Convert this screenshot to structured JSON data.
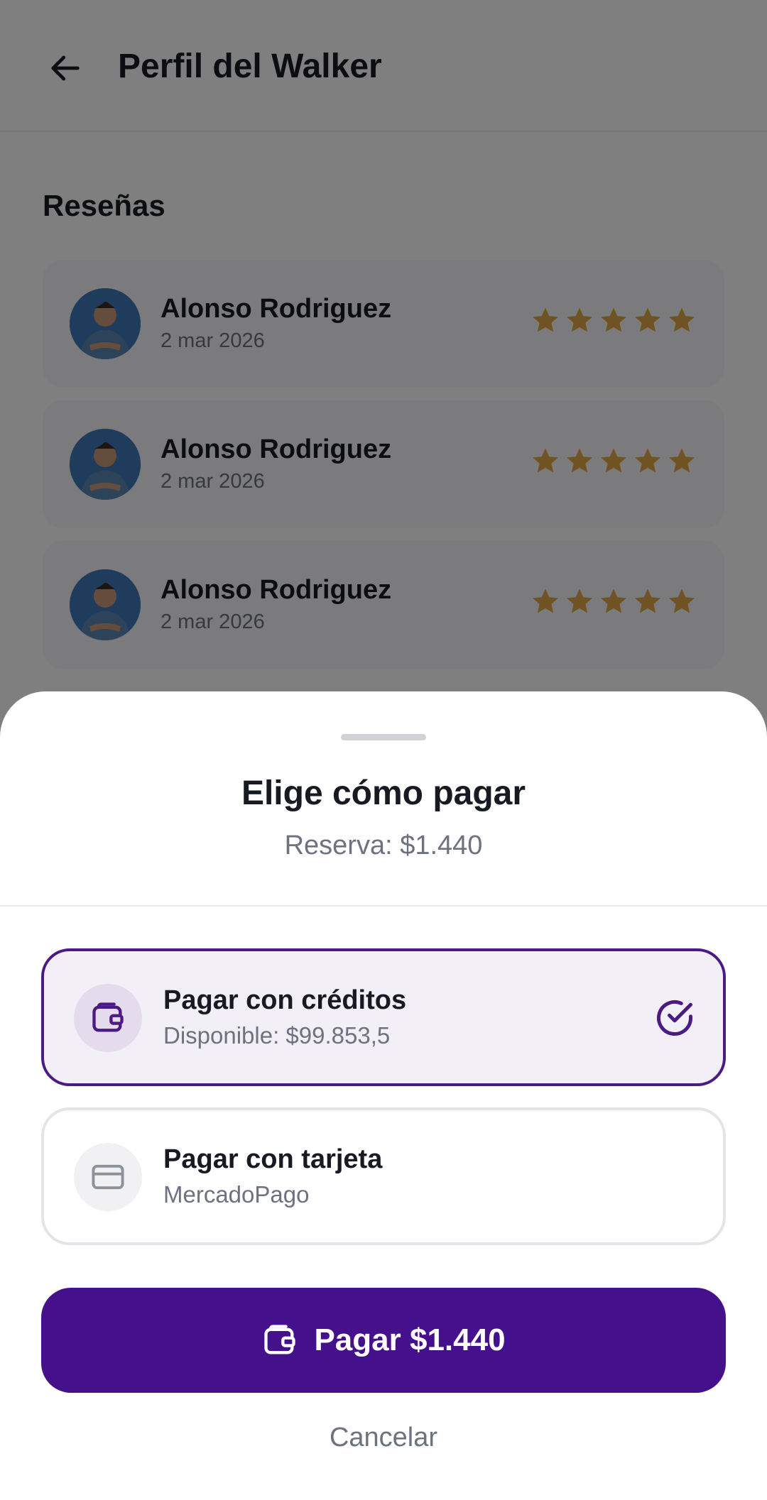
{
  "header": {
    "back_icon": "arrow-left-icon",
    "title": "Perfil del Walker"
  },
  "reviews": {
    "section_title": "Reseñas",
    "items": [
      {
        "name": "Alonso Rodriguez",
        "date": "2 mar 2026",
        "rating": 5
      },
      {
        "name": "Alonso Rodriguez",
        "date": "2 mar 2026",
        "rating": 5
      },
      {
        "name": "Alonso Rodriguez",
        "date": "2 mar 2026",
        "rating": 5
      }
    ],
    "star_color": "#e0a644"
  },
  "payment_sheet": {
    "title": "Elige cómo pagar",
    "subtitle": "Reserva: $1.440",
    "options": [
      {
        "label": "Pagar con créditos",
        "sub": "Disponible: $99.853,5",
        "icon": "wallet-icon",
        "selected": true
      },
      {
        "label": "Pagar con tarjeta",
        "sub": "MercadoPago",
        "icon": "credit-card-icon",
        "selected": false
      }
    ],
    "pay_button": {
      "label": "Pagar $1.440",
      "icon": "wallet-icon"
    },
    "cancel_label": "Cancelar"
  },
  "colors": {
    "primary": "#44108c",
    "selected_bg": "#f3eff7",
    "muted_text": "#6d7280",
    "scrim": "rgba(0,0,0,0.5)"
  }
}
